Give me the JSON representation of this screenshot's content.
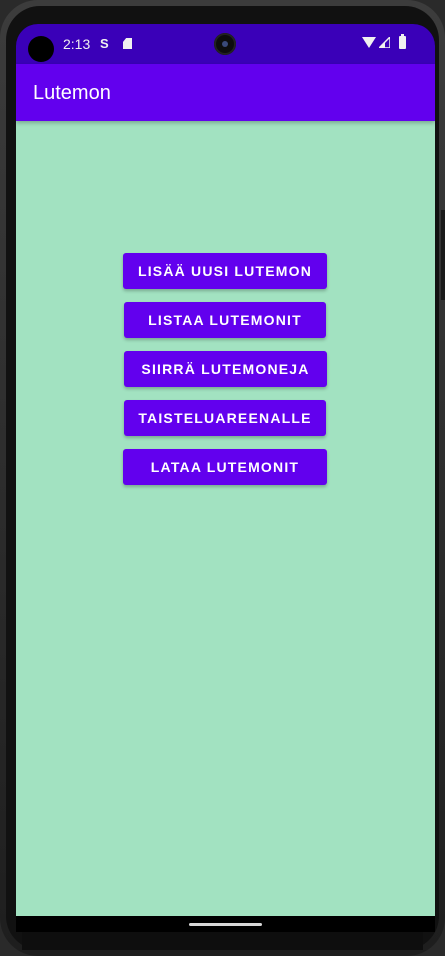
{
  "status_bar": {
    "time": "2:13",
    "icons": [
      "camera-cutout-icon",
      "sim-icon",
      "sd-card-icon",
      "front-camera-icon",
      "wifi-icon",
      "cell-signal-icon",
      "battery-icon"
    ],
    "sim_glyph": "S"
  },
  "app_bar": {
    "title": "Lutemon"
  },
  "main": {
    "buttons": [
      {
        "label": "LISÄÄ UUSI LUTEMON"
      },
      {
        "label": "LISTAA LUTEMONIT"
      },
      {
        "label": "SIIRRÄ LUTEMONEJA"
      },
      {
        "label": "TAISTELUAREENALLE"
      },
      {
        "label": "LATAA LUTEMONIT"
      }
    ]
  },
  "colors": {
    "status_bar": "#3a00b8",
    "app_bar": "#6200ee",
    "background": "#a2e2c1",
    "button": "#6200ee",
    "button_text": "#ffffff"
  }
}
